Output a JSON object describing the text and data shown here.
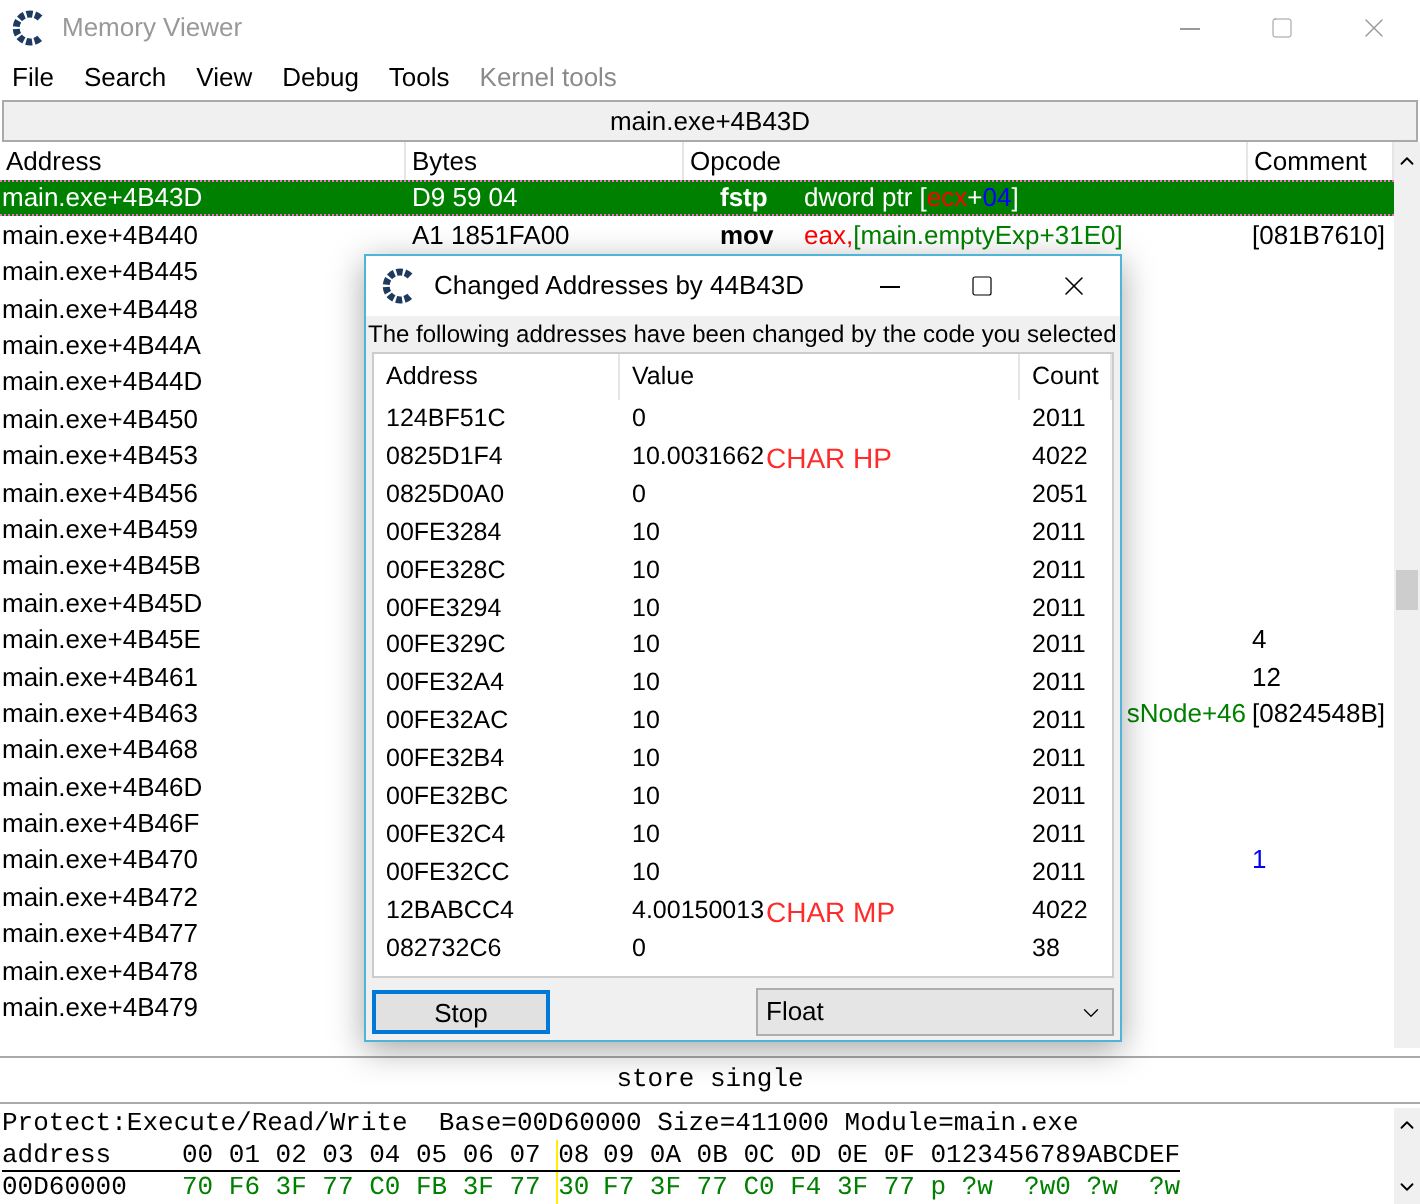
{
  "window": {
    "title": "Memory Viewer"
  },
  "menu": [
    {
      "label": "File",
      "disabled": false
    },
    {
      "label": "Search",
      "disabled": false
    },
    {
      "label": "View",
      "disabled": false
    },
    {
      "label": "Debug",
      "disabled": false
    },
    {
      "label": "Tools",
      "disabled": false
    },
    {
      "label": "Kernel tools",
      "disabled": true
    }
  ],
  "address_bar": "main.exe+4B43D",
  "disassembly": {
    "columns": [
      "Address",
      "Bytes",
      "Opcode",
      "Comment"
    ],
    "rows": [
      {
        "address": "main.exe+4B43D",
        "bytes": "D9 59 04",
        "mnemonic": "fstp",
        "operands": [
          {
            "text": "dword ptr [",
            "kind": "plain"
          },
          {
            "text": "ecx",
            "kind": "register"
          },
          {
            "text": "+",
            "kind": "plain"
          },
          {
            "text": "04",
            "kind": "number"
          },
          {
            "text": "]",
            "kind": "plain"
          }
        ],
        "selected": true
      },
      {
        "address": "main.exe+4B440",
        "bytes": "A1 1851FA00",
        "mnemonic": "mov",
        "operands": [
          {
            "text": "eax,",
            "kind": "register"
          },
          {
            "text": "[main.emptyExp+31E0]",
            "kind": "symbol"
          }
        ],
        "comment": {
          "text": "[081B7610]",
          "kind": "plain"
        },
        "selected": false
      },
      {
        "address": "main.exe+4B445",
        "selected": false
      },
      {
        "address": "main.exe+4B448",
        "selected": false
      },
      {
        "address": "main.exe+4B44A",
        "selected": false
      },
      {
        "address": "main.exe+4B44D",
        "selected": false
      },
      {
        "address": "main.exe+4B450",
        "selected": false
      },
      {
        "address": "main.exe+4B453",
        "selected": false
      },
      {
        "address": "main.exe+4B456",
        "selected": false
      },
      {
        "address": "main.exe+4B459",
        "selected": false
      },
      {
        "address": "main.exe+4B45B",
        "selected": false
      },
      {
        "address": "main.exe+4B45D",
        "selected": false
      },
      {
        "address": "main.exe+4B45E",
        "comment": {
          "text": "4",
          "kind": "plain"
        },
        "selected": false
      },
      {
        "address": "main.exe+4B461",
        "comment": {
          "text": "12",
          "kind": "plain"
        },
        "selected": false
      },
      {
        "address": "main.exe+4B463",
        "operands": [
          {
            "text": "sNode+46",
            "kind": "symbol"
          }
        ],
        "comment": {
          "text": "[0824548B]",
          "kind": "plain"
        },
        "selected": false
      },
      {
        "address": "main.exe+4B468",
        "selected": false
      },
      {
        "address": "main.exe+4B46D",
        "selected": false
      },
      {
        "address": "main.exe+4B46F",
        "selected": false
      },
      {
        "address": "main.exe+4B470",
        "comment": {
          "text": "1",
          "kind": "number"
        },
        "selected": false
      },
      {
        "address": "main.exe+4B472",
        "selected": false
      },
      {
        "address": "main.exe+4B477",
        "selected": false
      },
      {
        "address": "main.exe+4B478",
        "selected": false
      },
      {
        "address": "main.exe+4B479",
        "selected": false
      }
    ]
  },
  "instruction_description": "store single",
  "hex_view": {
    "info": "Protect:Execute/Read/Write  Base=00D60000 Size=411000 Module=main.exe",
    "header": {
      "label": "address",
      "bytes": [
        "00",
        "01",
        "02",
        "03",
        "04",
        "05",
        "06",
        "07",
        "08",
        "09",
        "0A",
        "0B",
        "0C",
        "0D",
        "0E",
        "0F"
      ],
      "ascii": "0123456789ABCDEF"
    },
    "rows": [
      {
        "address": "00D60000",
        "bytes": [
          "70",
          "F6",
          "3F",
          "77",
          "C0",
          "FB",
          "3F",
          "77",
          "30",
          "F7",
          "3F",
          "77",
          "C0",
          "F4",
          "3F",
          "77"
        ],
        "ascii": "p ?w  ?w0 ?w  ?w"
      }
    ]
  },
  "dialog": {
    "title": "Changed Addresses by 44B43D",
    "message": "The following addresses have been changed by the code you selected",
    "columns": [
      "Address",
      "Value",
      "Count"
    ],
    "rows": [
      {
        "address": "124BF51C",
        "value": "0",
        "count": "2011"
      },
      {
        "address": "0825D1F4",
        "value": "10.0031662",
        "note": "CHAR HP",
        "count": "4022"
      },
      {
        "address": "0825D0A0",
        "value": "0",
        "count": "2051"
      },
      {
        "address": "00FE3284",
        "value": "10",
        "count": "2011"
      },
      {
        "address": "00FE328C",
        "value": "10",
        "count": "2011"
      },
      {
        "address": "00FE3294",
        "value": "10",
        "count": "2011"
      },
      {
        "address": "00FE329C",
        "value": "10",
        "count": "2011"
      },
      {
        "address": "00FE32A4",
        "value": "10",
        "count": "2011"
      },
      {
        "address": "00FE32AC",
        "value": "10",
        "count": "2011"
      },
      {
        "address": "00FE32B4",
        "value": "10",
        "count": "2011"
      },
      {
        "address": "00FE32BC",
        "value": "10",
        "count": "2011"
      },
      {
        "address": "00FE32C4",
        "value": "10",
        "count": "2011"
      },
      {
        "address": "00FE32CC",
        "value": "10",
        "count": "2011"
      },
      {
        "address": "12BABCC4",
        "value": "4.00150013",
        "note": "CHAR MP",
        "count": "4022"
      },
      {
        "address": "082732C6",
        "value": "0",
        "count": "38"
      }
    ],
    "stop_button": "Stop",
    "value_type": "Float"
  }
}
